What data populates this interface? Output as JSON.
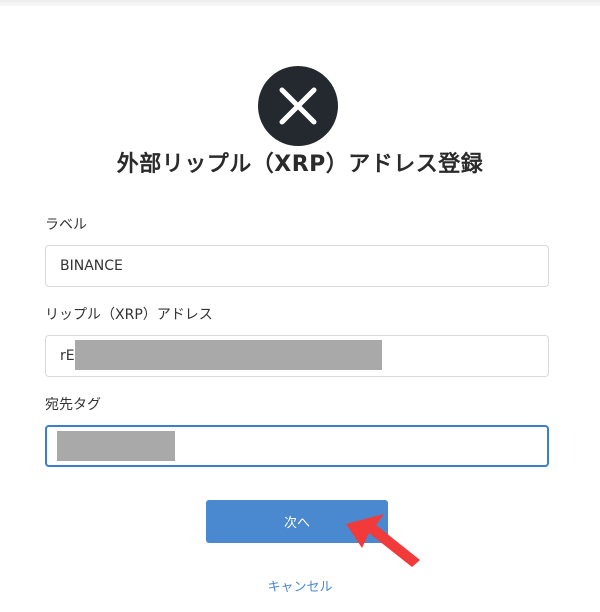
{
  "page": {
    "title": "外部リップル（XRP）アドレス登録",
    "logo_icon": "xrp-logo-icon"
  },
  "form": {
    "label_field": {
      "label": "ラベル",
      "value": "BINANCE"
    },
    "address_field": {
      "label": "リップル（XRP）アドレス",
      "value": "rE",
      "redacted": true
    },
    "tag_field": {
      "label": "宛先タグ",
      "value": "",
      "redacted": true,
      "focused": true
    }
  },
  "actions": {
    "next_label": "次へ",
    "cancel_label": "キャンセル"
  },
  "annotation": {
    "pointer_arrow_icon": "red-arrow-icon",
    "color": "#f23a3a"
  },
  "colors": {
    "accent": "#4a88cf",
    "logo_bg": "#23292f",
    "redaction": "#a9a9a9"
  }
}
